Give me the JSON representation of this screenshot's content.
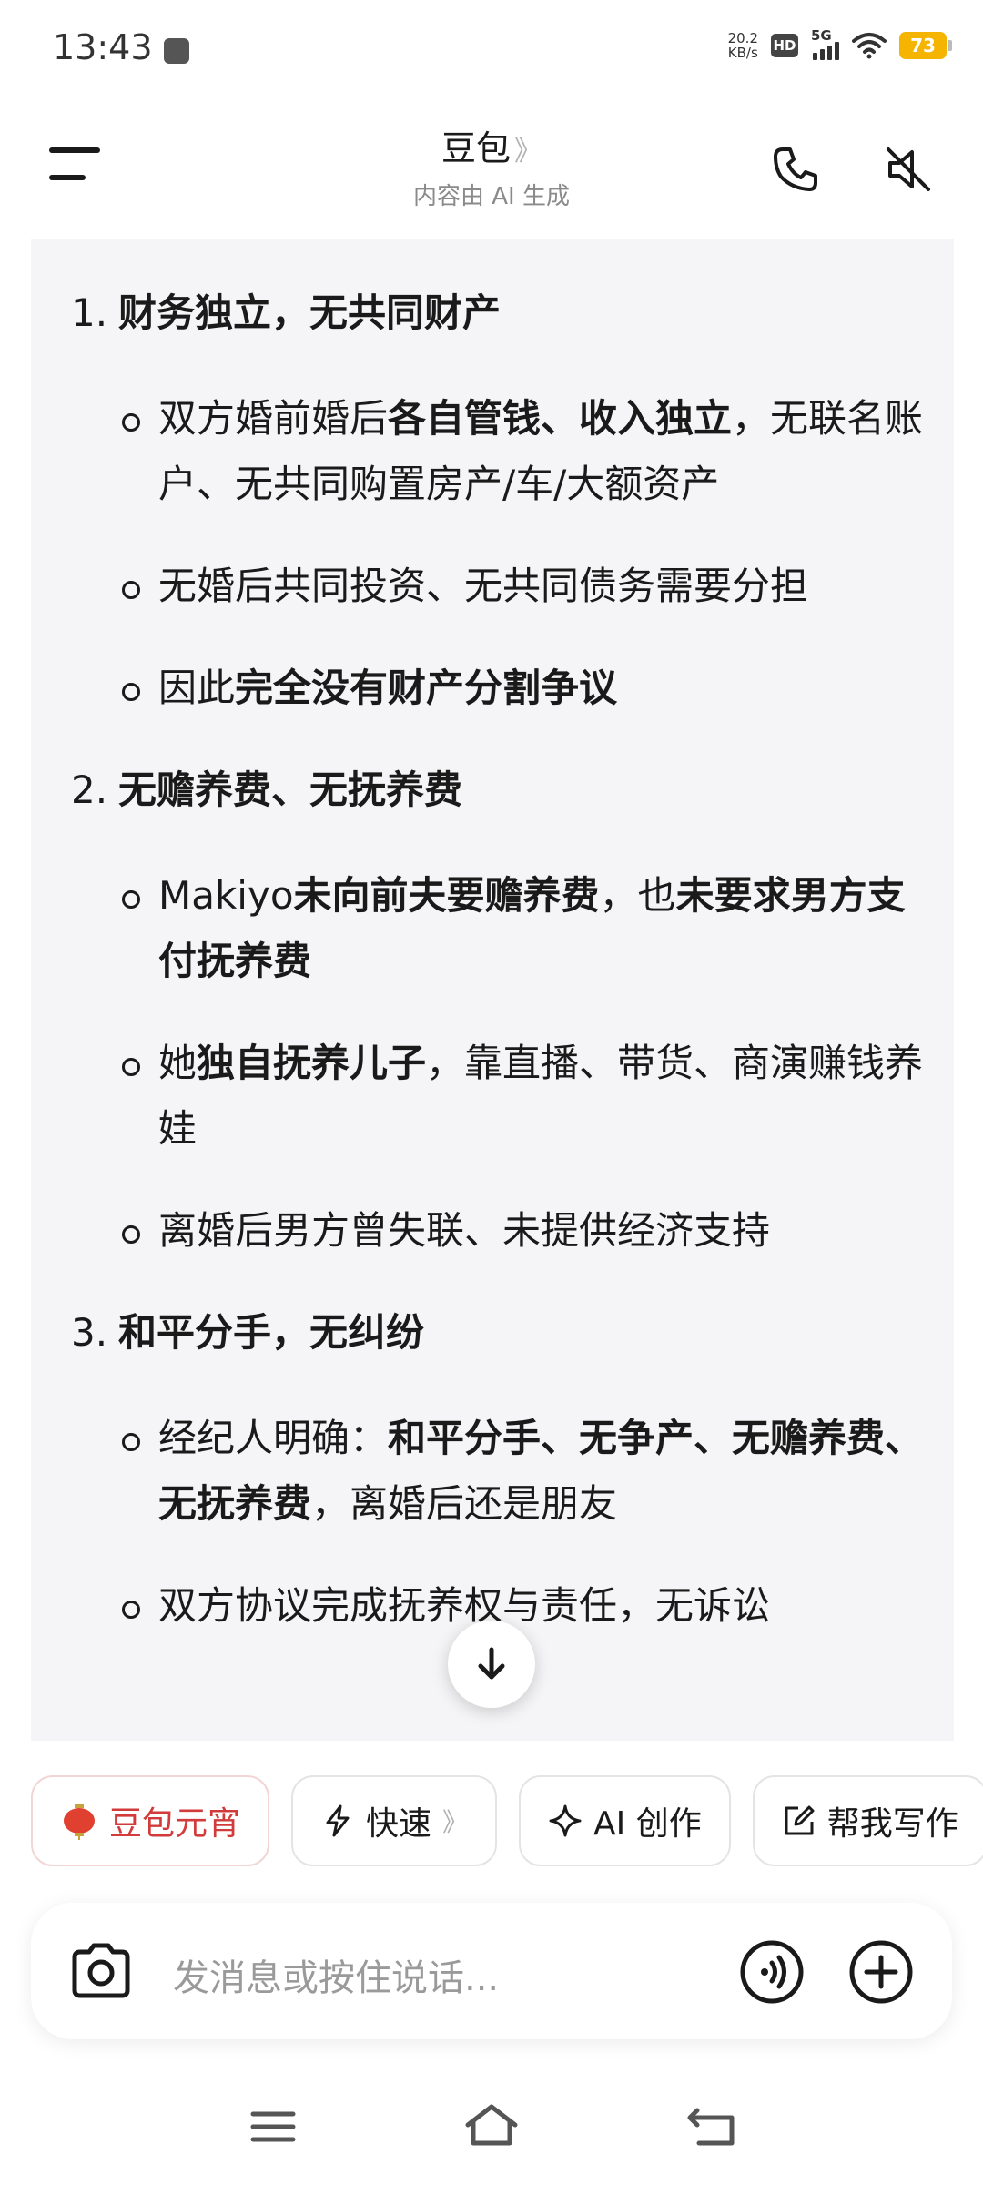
{
  "status_bar": {
    "time": "13:43",
    "net_speed_value": "20.2",
    "net_speed_unit": "KB/s",
    "hd_label": "HD",
    "network_label": "5G",
    "battery_level": "73"
  },
  "header": {
    "title": "豆包",
    "title_chevron": "》",
    "subtitle": "内容由 AI 生成"
  },
  "content": {
    "items": [
      {
        "number": "1.",
        "heading": "财务独立，无共同财产",
        "points": [
          [
            {
              "t": "双方婚前婚后",
              "b": false
            },
            {
              "t": "各自管钱、收入独立",
              "b": true
            },
            {
              "t": "，无联名账户、无共同购置房产/车/大额资产",
              "b": false
            }
          ],
          [
            {
              "t": "无婚后共同投资、无共同债务需要分担",
              "b": false
            }
          ],
          [
            {
              "t": "因此",
              "b": false
            },
            {
              "t": "完全没有财产分割争议",
              "b": true
            }
          ]
        ]
      },
      {
        "number": "2.",
        "heading": "无赡养费、无抚养费",
        "points": [
          [
            {
              "t": "Makiyo",
              "b": false
            },
            {
              "t": "未向前夫要赡养费",
              "b": true
            },
            {
              "t": "，也",
              "b": false
            },
            {
              "t": "未要求男方支付抚养费",
              "b": true
            }
          ],
          [
            {
              "t": "她",
              "b": false
            },
            {
              "t": "独自抚养儿子",
              "b": true
            },
            {
              "t": "，靠直播、带货、商演赚钱养娃",
              "b": false
            }
          ],
          [
            {
              "t": "离婚后男方曾失联、未提供经济支持",
              "b": false
            }
          ]
        ]
      },
      {
        "number": "3.",
        "heading": "和平分手，无纠纷",
        "points": [
          [
            {
              "t": "经纪人明确：",
              "b": false
            },
            {
              "t": "和平分手、无争产、无赡养费、无抚养费",
              "b": true
            },
            {
              "t": "，离婚后还是朋友",
              "b": false
            }
          ],
          [
            {
              "t": "双方协议完成抚养权与责任，无诉讼",
              "b": false
            }
          ]
        ]
      }
    ]
  },
  "chips": [
    {
      "label": "豆包元宵",
      "icon": "lantern-icon",
      "chevron": ""
    },
    {
      "label": "快速",
      "icon": "lightning-icon",
      "chevron": "》"
    },
    {
      "label": "AI 创作",
      "icon": "sparkle-icon",
      "chevron": ""
    },
    {
      "label": "帮我写作",
      "icon": "edit-icon",
      "chevron": ""
    }
  ],
  "input": {
    "placeholder": "发消息或按住说话..."
  },
  "colors": {
    "content_bg": "#f5f5f7",
    "accent_red": "#d23b3b",
    "battery": "#f4b400"
  }
}
